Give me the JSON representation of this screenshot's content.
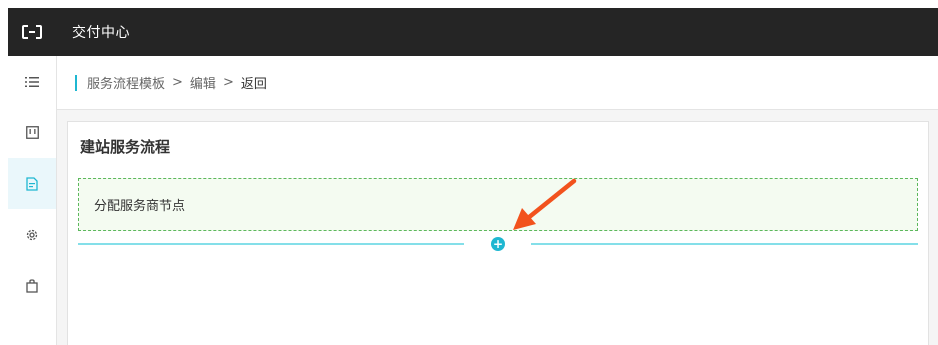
{
  "header": {
    "app_title": "交付中心"
  },
  "sidebar": {
    "items": [
      {
        "icon": "list-icon",
        "active": false
      },
      {
        "icon": "board-icon",
        "active": false
      },
      {
        "icon": "document-icon",
        "active": true
      },
      {
        "icon": "gear-icon",
        "active": false
      },
      {
        "icon": "bag-icon",
        "active": false
      }
    ]
  },
  "breadcrumb": {
    "items": [
      "服务流程模板",
      "编辑",
      "返回"
    ],
    "separator": ">"
  },
  "main": {
    "title": "建站服务流程",
    "node_label": "分配服务商节点",
    "add_button": "+"
  },
  "colors": {
    "accent": "#1fb7d1",
    "header_bg": "#252525",
    "node_border": "#5cb85c",
    "annotation_arrow": "#f2521d"
  }
}
